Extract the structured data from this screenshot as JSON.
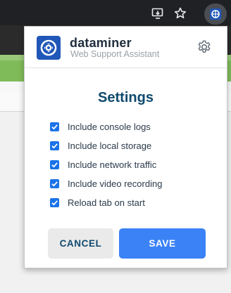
{
  "browser": {
    "icons": [
      "cast-icon",
      "star-icon",
      "extension-icon"
    ]
  },
  "popup": {
    "brand": {
      "name": "dataminer",
      "subtitle": "Web Support Assistant",
      "logo_color": "#2057b8"
    },
    "settings_icon": "gear-icon",
    "title": "Settings",
    "options": [
      {
        "label": "Include console logs",
        "checked": true
      },
      {
        "label": "Include local storage",
        "checked": true
      },
      {
        "label": "Include network traffic",
        "checked": true
      },
      {
        "label": "Include video recording",
        "checked": true
      },
      {
        "label": "Reload tab on start",
        "checked": true
      }
    ],
    "buttons": {
      "cancel": "CANCEL",
      "save": "SAVE"
    },
    "colors": {
      "accent": "#3b82f6",
      "title": "#0e4a6e",
      "checkbox": "#1a73e8"
    }
  }
}
